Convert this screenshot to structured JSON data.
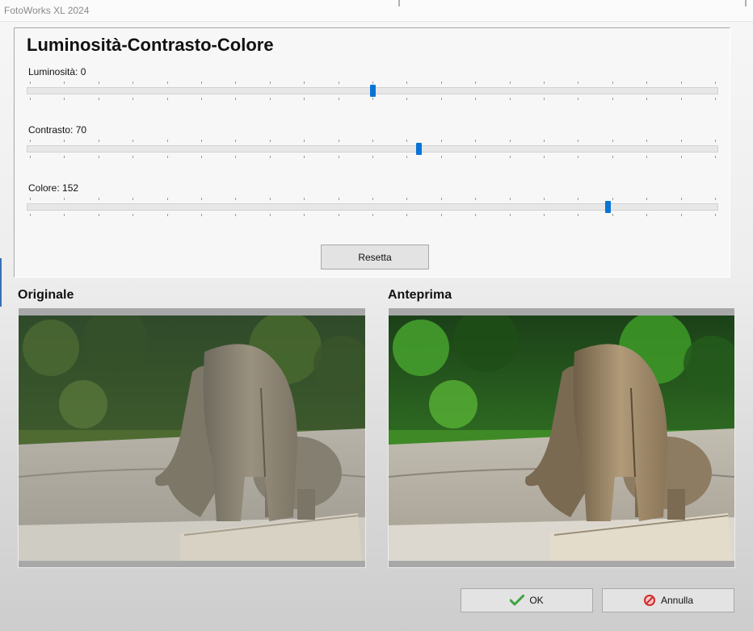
{
  "window": {
    "title": "FotoWorks XL 2024"
  },
  "panel": {
    "title": "Luminosità-Contrasto-Colore",
    "sliders": [
      {
        "label": "Luminosità: 0",
        "min": -100,
        "max": 100,
        "value": 0
      },
      {
        "label": "Contrasto: 70",
        "min": -100,
        "max": 200,
        "value": 70
      },
      {
        "label": "Colore: 152",
        "min": -100,
        "max": 200,
        "value": 152
      }
    ],
    "reset_label": "Resetta"
  },
  "previews": {
    "original_label": "Originale",
    "preview_label": "Anteprima"
  },
  "buttons": {
    "ok_label": "OK",
    "cancel_label": "Annulla"
  },
  "icons": {
    "ok": "checkmark-icon",
    "cancel": "no-entry-icon"
  },
  "colors": {
    "accent": "#0a74d6",
    "ok_check": "#3fa33f",
    "cancel_red": "#d12a2a"
  }
}
